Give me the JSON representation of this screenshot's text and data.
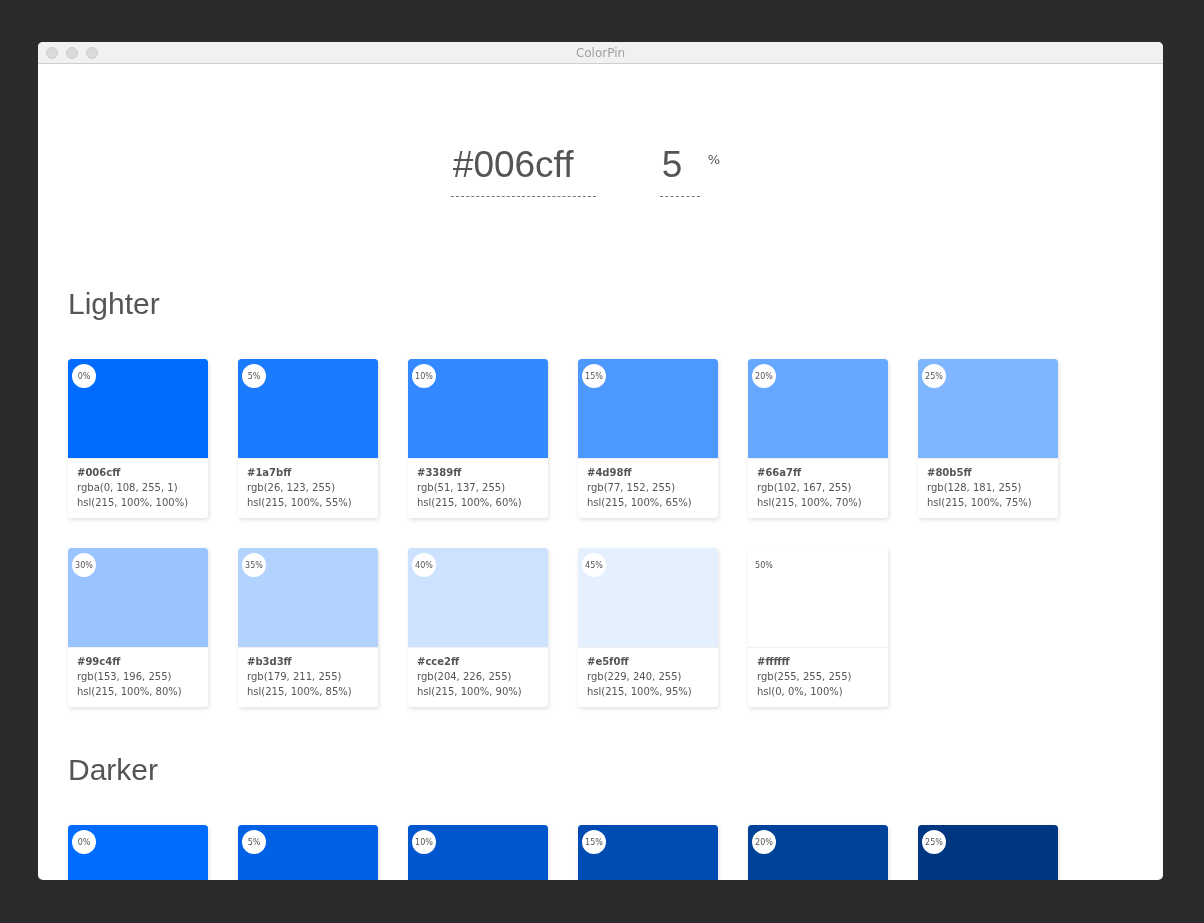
{
  "window": {
    "title": "ColorPin"
  },
  "color_input": {
    "value": "#006cff"
  },
  "step_input": {
    "value": "5",
    "unit": "%"
  },
  "sections": [
    {
      "title": "Lighter",
      "swatches": [
        {
          "badge": "0%",
          "color": "#006cff",
          "hex": "#006cff",
          "rgb": "rgba(0, 108, 255, 1)",
          "hsl": "hsl(215, 100%, 100%)"
        },
        {
          "badge": "5%",
          "color": "#1a7bff",
          "hex": "#1a7bff",
          "rgb": "rgb(26, 123, 255)",
          "hsl": "hsl(215, 100%, 55%)"
        },
        {
          "badge": "10%",
          "color": "#3389ff",
          "hex": "#3389ff",
          "rgb": "rgb(51, 137, 255)",
          "hsl": "hsl(215, 100%, 60%)"
        },
        {
          "badge": "15%",
          "color": "#4d98ff",
          "hex": "#4d98ff",
          "rgb": "rgb(77, 152, 255)",
          "hsl": "hsl(215, 100%, 65%)"
        },
        {
          "badge": "20%",
          "color": "#66a7ff",
          "hex": "#66a7ff",
          "rgb": "rgb(102, 167, 255)",
          "hsl": "hsl(215, 100%, 70%)"
        },
        {
          "badge": "25%",
          "color": "#80b5ff",
          "hex": "#80b5ff",
          "rgb": "rgb(128, 181, 255)",
          "hsl": "hsl(215, 100%, 75%)"
        },
        {
          "badge": "30%",
          "color": "#99c4ff",
          "hex": "#99c4ff",
          "rgb": "rgb(153, 196, 255)",
          "hsl": "hsl(215, 100%, 80%)"
        },
        {
          "badge": "35%",
          "color": "#b3d3ff",
          "hex": "#b3d3ff",
          "rgb": "rgb(179, 211, 255)",
          "hsl": "hsl(215, 100%, 85%)"
        },
        {
          "badge": "40%",
          "color": "#cce2ff",
          "hex": "#cce2ff",
          "rgb": "rgb(204, 226, 255)",
          "hsl": "hsl(215, 100%, 90%)"
        },
        {
          "badge": "45%",
          "color": "#e5f0ff",
          "hex": "#e5f0ff",
          "rgb": "rgb(229, 240, 255)",
          "hsl": "hsl(215, 100%, 95%)"
        },
        {
          "badge": "50%",
          "color": "#ffffff",
          "hex": "#ffffff",
          "rgb": "rgb(255, 255, 255)",
          "hsl": "hsl(0, 0%, 100%)"
        }
      ]
    },
    {
      "title": "Darker",
      "swatches": [
        {
          "badge": "0%",
          "color": "#006cff"
        },
        {
          "badge": "5%",
          "color": "#0061e6"
        },
        {
          "badge": "10%",
          "color": "#0056cc"
        },
        {
          "badge": "15%",
          "color": "#004cb3"
        },
        {
          "badge": "20%",
          "color": "#004199"
        },
        {
          "badge": "25%",
          "color": "#003680"
        }
      ]
    }
  ]
}
